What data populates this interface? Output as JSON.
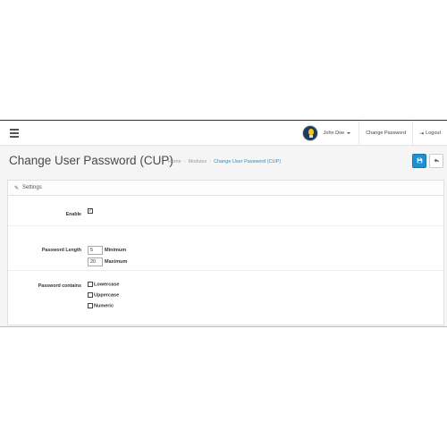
{
  "topbar": {
    "user_name": "John Doe",
    "change_password": "Change Password",
    "logout": "Logout"
  },
  "header": {
    "title": "Change User Password (CUP)",
    "breadcrumb": [
      "Home",
      "Modules",
      "Change User Password (CUP)"
    ],
    "breadcrumb_separator": "›"
  },
  "panel": {
    "heading": "Settings"
  },
  "form": {
    "enable": {
      "label": "Enable",
      "checked": true
    },
    "password_length": {
      "label": "Password Length",
      "min_value": "5",
      "min_label": "Minimum",
      "max_value": "20",
      "max_label": "Maximum"
    },
    "password_contains": {
      "label": "Password contains",
      "options": [
        {
          "label": "Lowercase",
          "checked": false
        },
        {
          "label": "Uppercase",
          "checked": false
        },
        {
          "label": "Numeric",
          "checked": false
        }
      ]
    }
  },
  "icons": {
    "menu": "hamburger-icon",
    "save": "save-icon",
    "back": "reply-icon",
    "settings": "pencil-icon",
    "logout": "sign-out-icon"
  },
  "colors": {
    "accent": "#1e91cf",
    "background": "#f5f5f5"
  }
}
